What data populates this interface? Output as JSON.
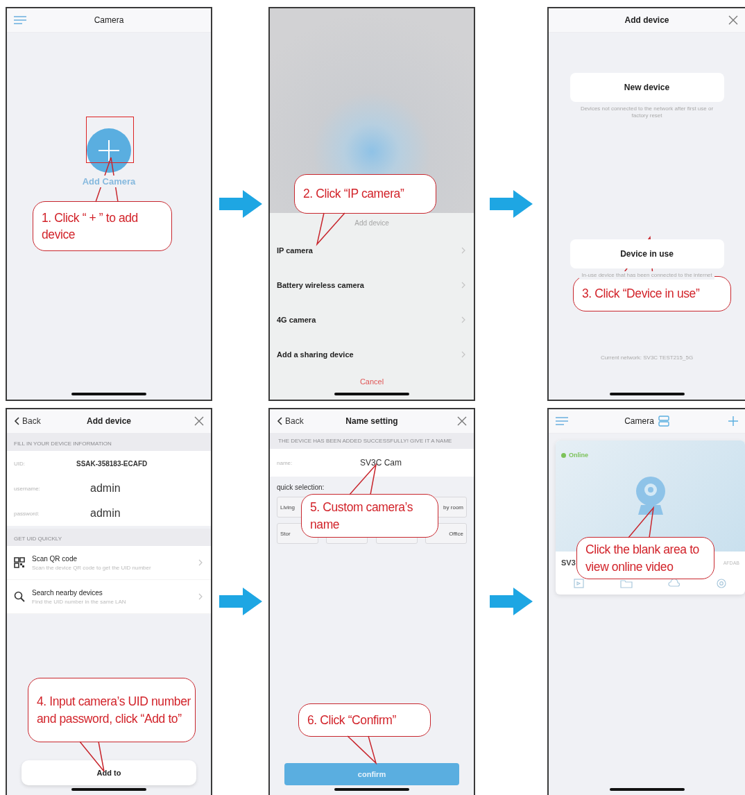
{
  "panels": [
    {
      "kind": "home",
      "title": "Camera",
      "add_label": "Add Camera",
      "callouts": [
        "1. Click “ + ” to add device"
      ]
    },
    {
      "kind": "sheet",
      "sheet_title": "Add device",
      "items": [
        "IP camera",
        "Battery wireless camera",
        "4G camera",
        "Add a sharing device"
      ],
      "cancel": "Cancel",
      "callouts": [
        "2. Click “IP camera”"
      ]
    },
    {
      "kind": "choose",
      "title": "Add device",
      "options": [
        {
          "label": "New device",
          "hint": "Devices not connected to the network after first use or factory reset"
        },
        {
          "label": "Device in use",
          "hint": "In-use device that has been connected to the internet"
        }
      ],
      "network": "Current network:  SV3C TEST215_5G",
      "callouts": [
        "3. Click “Device in use”"
      ]
    },
    {
      "kind": "form",
      "back": "Back",
      "title": "Add device",
      "section_1": "FILL IN YOUR DEVICE INFORMATION",
      "fields": [
        {
          "label": "UID:",
          "value": "SSAK-358183-ECAFD",
          "kind": "uid"
        },
        {
          "label": "username:",
          "value": "admin",
          "kind": "text"
        },
        {
          "label": "password:",
          "value": "admin",
          "kind": "text"
        }
      ],
      "section_2": "GET UID QUICKLY",
      "options": [
        {
          "kind": "qr",
          "title": "Scan QR code",
          "subtitle": "Scan the device QR code to get the UID number"
        },
        {
          "kind": "search",
          "title": "Search nearby devices",
          "subtitle": "Find the UID number in the same LAN"
        }
      ],
      "button": "Add to",
      "callouts": [
        "4. Input camera’s UID number and password, click “Add to”"
      ]
    },
    {
      "kind": "name",
      "back": "Back",
      "title": "Name setting",
      "notice": "THE DEVICE HAS BEEN ADDED SUCCESSFULLY! GIVE IT A NAME",
      "field": {
        "label": "name:",
        "value": "SV3C Cam"
      },
      "quick_label": "quick selection:",
      "chip_rows": [
        [
          {
            "kind": "label",
            "label": "Living"
          },
          {
            "kind": "label",
            "label": "by room"
          }
        ],
        [
          {
            "kind": "label",
            "label": "Stor"
          },
          {
            "kind": "blank"
          },
          {
            "kind": "blank"
          },
          {
            "kind": "label",
            "label": "Office"
          }
        ]
      ],
      "button": "confirm",
      "callouts": [
        "5. Custom camera’s name",
        "6. Click “Confirm”"
      ]
    },
    {
      "kind": "list",
      "title": "Camera",
      "card": {
        "status": "Online",
        "online": true,
        "name": "SV3",
        "uid": "AFDAB"
      },
      "callouts": [
        "Click the blank area to view online video"
      ]
    }
  ]
}
